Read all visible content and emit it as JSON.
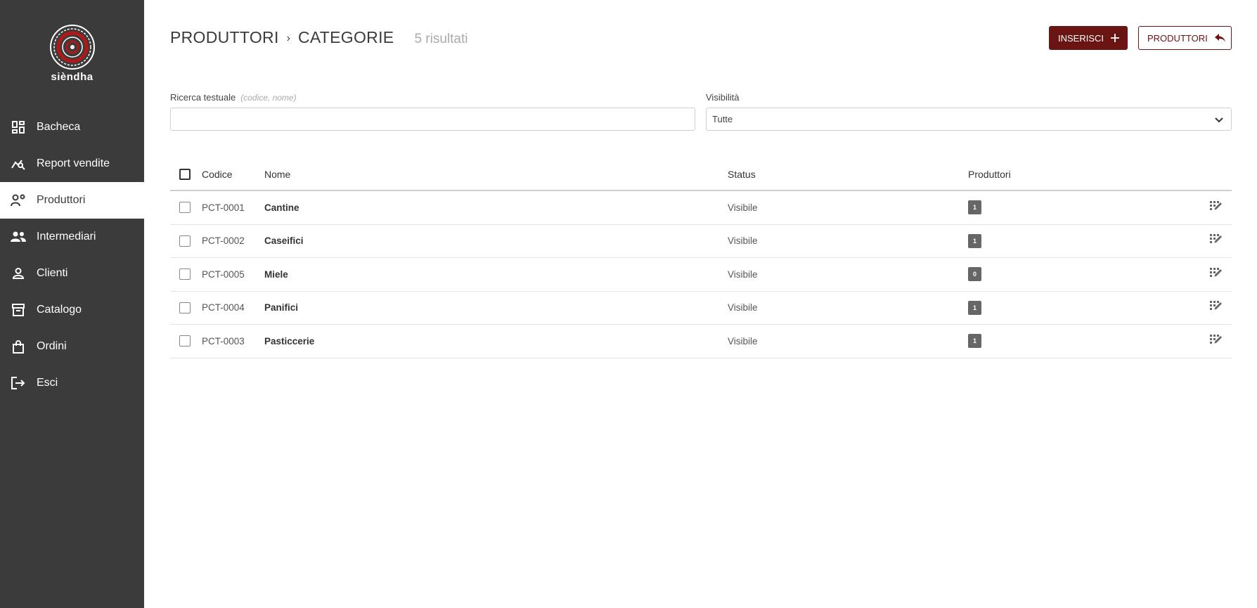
{
  "brand": {
    "name": "sièndha"
  },
  "sidebar": {
    "items": [
      {
        "label": "Bacheca",
        "icon": "dashboard-icon"
      },
      {
        "label": "Report vendite",
        "icon": "chart-search-icon"
      },
      {
        "label": "Produttori",
        "icon": "person-gear-icon",
        "active": true
      },
      {
        "label": "Intermediari",
        "icon": "people-icon"
      },
      {
        "label": "Clienti",
        "icon": "person-icon"
      },
      {
        "label": "Catalogo",
        "icon": "archive-icon"
      },
      {
        "label": "Ordini",
        "icon": "shopping-bag-icon"
      },
      {
        "label": "Esci",
        "icon": "logout-icon"
      }
    ]
  },
  "header": {
    "crumb1": "PRODUTTORI",
    "separator": "›",
    "crumb2": "CATEGORIE",
    "result_count": "5 risultati"
  },
  "actions": {
    "insert_label": "INSERISCI",
    "back_label": "PRODUTTORI"
  },
  "filters": {
    "search_label": "Ricerca testuale",
    "search_hint": "(codice, nome)",
    "search_value": "",
    "visibility_label": "Visibilità",
    "visibility_value": "Tutte"
  },
  "table": {
    "columns": {
      "code": "Codice",
      "name": "Nome",
      "status": "Status",
      "producers": "Produttori"
    },
    "rows": [
      {
        "code": "PCT-0001",
        "name": "Cantine",
        "status": "Visibile",
        "producers": "1"
      },
      {
        "code": "PCT-0002",
        "name": "Caseifici",
        "status": "Visibile",
        "producers": "1"
      },
      {
        "code": "PCT-0005",
        "name": "Miele",
        "status": "Visibile",
        "producers": "0"
      },
      {
        "code": "PCT-0004",
        "name": "Panifici",
        "status": "Visibile",
        "producers": "1"
      },
      {
        "code": "PCT-0003",
        "name": "Pasticcerie",
        "status": "Visibile",
        "producers": "1"
      }
    ]
  },
  "colors": {
    "sidebar": "#3b3b3b",
    "accent": "#6b1414",
    "badge": "#666666"
  }
}
